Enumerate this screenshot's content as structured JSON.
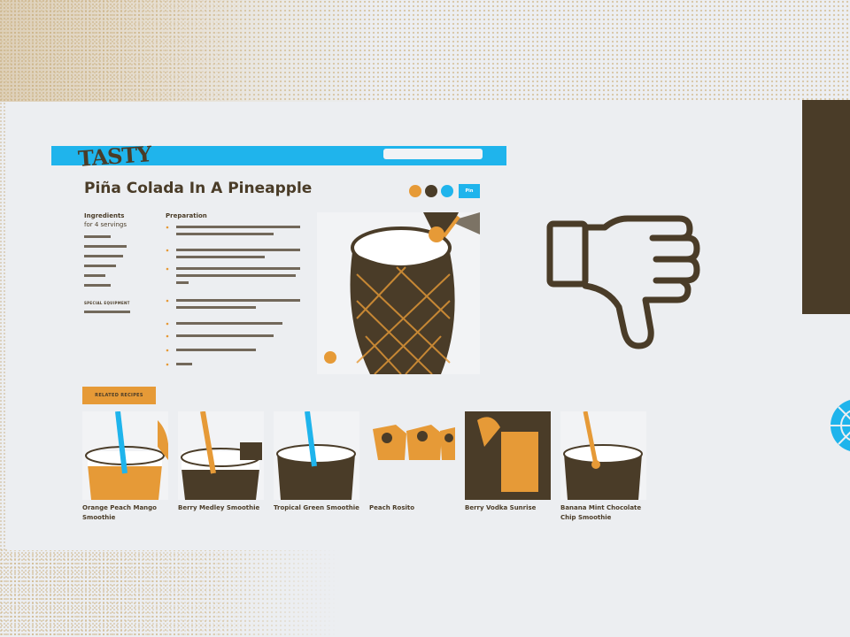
{
  "site": {
    "logo_text": "TASTY",
    "recipe_title": "Piña Colada In A Pineapple",
    "save_label": "Pin",
    "ingredients": {
      "heading": "Ingredients",
      "servings": "for 4 servings",
      "special_equipment_heading": "SPECIAL EQUIPMENT"
    },
    "preparation": {
      "heading": "Preparation"
    },
    "related": {
      "label": "RELATED RECIPES",
      "cards": [
        {
          "title": "Orange Peach Mango Smoothie"
        },
        {
          "title": "Berry Medley Smoothie"
        },
        {
          "title": "Tropical Green Smoothie"
        },
        {
          "title": "Peach Rosito"
        },
        {
          "title": "Berry Vodka Sunrise"
        },
        {
          "title": "Banana Mint Chocolate Chip Smoothie"
        }
      ]
    }
  },
  "colors": {
    "brand_blue": "#1fb4ec",
    "accent_orange": "#e69a37",
    "dark_brown": "#4a3c28",
    "background": "#eceef1"
  },
  "icons": [
    "thumbs-down-icon",
    "globe-icon",
    "play-icon",
    "facebook-icon",
    "pinterest-icon",
    "twitter-icon"
  ]
}
